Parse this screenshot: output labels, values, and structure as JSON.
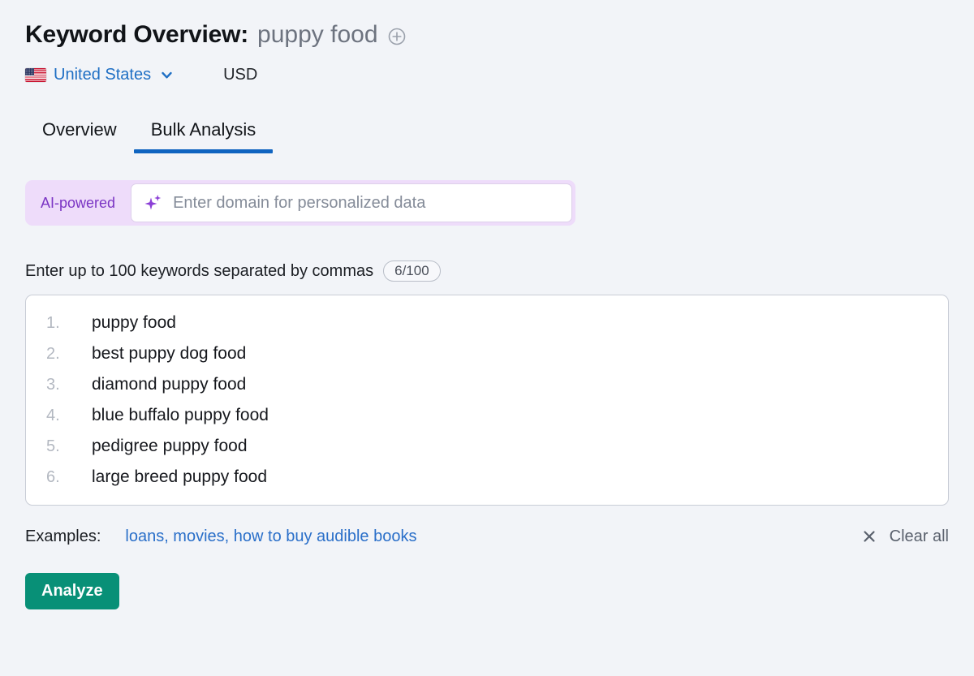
{
  "header": {
    "title_prefix": "Keyword Overview:",
    "keyword": "puppy food",
    "add_icon": "plus-circle-icon"
  },
  "locale": {
    "flag_icon": "us-flag-icon",
    "country": "United States",
    "chevron_icon": "chevron-down-icon",
    "currency": "USD"
  },
  "tabs": [
    {
      "label": "Overview",
      "active": false
    },
    {
      "label": "Bulk Analysis",
      "active": true
    }
  ],
  "ai_row": {
    "badge": "AI-powered",
    "sparkle_icon": "sparkle-icon",
    "domain_value": "",
    "domain_placeholder": "Enter domain for personalized data"
  },
  "keywords_section": {
    "label": "Enter up to 100 keywords separated by commas",
    "count": "6/100",
    "items": [
      {
        "num": "1.",
        "text": "puppy food"
      },
      {
        "num": "2.",
        "text": "best puppy dog food"
      },
      {
        "num": "3.",
        "text": "diamond puppy food"
      },
      {
        "num": "4.",
        "text": "blue buffalo puppy food"
      },
      {
        "num": "5.",
        "text": "pedigree puppy food"
      },
      {
        "num": "6.",
        "text": "large breed puppy food"
      }
    ]
  },
  "examples": {
    "label": "Examples:",
    "links": "loans, movies, how to buy audible books",
    "clear_icon": "close-x-icon",
    "clear_label": "Clear all"
  },
  "actions": {
    "analyze_label": "Analyze"
  },
  "colors": {
    "background": "#f2f4f8",
    "accent_blue": "#1064c0",
    "link_blue": "#2a6fc9",
    "ai_purple": "#7b35c4",
    "ai_badge_bg": "#eedcfa",
    "analyze_green": "#089077"
  }
}
